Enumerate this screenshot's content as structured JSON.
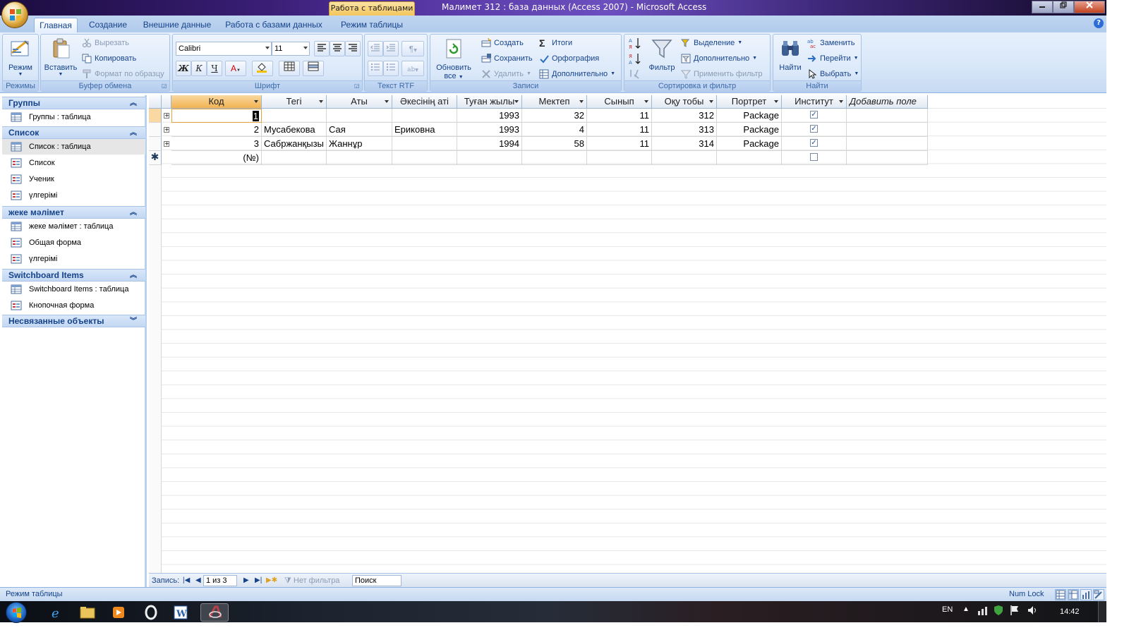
{
  "window": {
    "context_tab": "Работа с таблицами",
    "title": "Малимет 312 : база данных (Access 2007) - Microsoft Access",
    "minimize": "0",
    "restore": "1",
    "close": "r",
    "help": "?"
  },
  "tabs": [
    "Главная",
    "Создание",
    "Внешние данные",
    "Работа с базами данных",
    "Режим таблицы"
  ],
  "ribbon": {
    "modes": {
      "view_label": "Режим",
      "group": "Режимы"
    },
    "clipboard": {
      "paste_label": "Вставить",
      "cut": "Вырезать",
      "copy": "Копировать",
      "format_painter": "Формат по образцу",
      "group": "Буфер обмена"
    },
    "font": {
      "font_name": "Calibri",
      "font_size": "11",
      "bold": "Ж",
      "italic": "К",
      "underline": "Ч",
      "font_color": "A",
      "group": "Шрифт"
    },
    "rtf": {
      "group": "Текст RTF"
    },
    "records": {
      "refresh_label_1": "Обновить",
      "refresh_label_2": "все",
      "new": "Создать",
      "save": "Сохранить",
      "delete": "Удалить",
      "totals": "Итоги",
      "spelling": "Орфография",
      "more": "Дополнительно",
      "group": "Записи"
    },
    "sort_filter": {
      "filter_label": "Фильтр",
      "selection": "Выделение",
      "advanced": "Дополнительно",
      "apply_filter": "Применить фильтр",
      "group": "Сортировка и фильтр"
    },
    "find": {
      "find_label": "Найти",
      "replace": "Заменить",
      "goto": "Перейти",
      "select": "Выбрать",
      "group": "Найти"
    }
  },
  "nav": {
    "groups": [
      {
        "title": "Группы",
        "items": [
          {
            "label": "Группы : таблица",
            "type": "table"
          }
        ]
      },
      {
        "title": "Список",
        "items": [
          {
            "label": "Список : таблица",
            "type": "table",
            "selected": true
          },
          {
            "label": "Список",
            "type": "form"
          },
          {
            "label": "Ученик",
            "type": "form"
          },
          {
            "label": "үлгерімі",
            "type": "form"
          }
        ]
      },
      {
        "title": "жеке мәлімет",
        "items": [
          {
            "label": "жеке мәлімет : таблица",
            "type": "table"
          },
          {
            "label": "Общая форма",
            "type": "form"
          },
          {
            "label": "үлгерімі",
            "type": "form"
          }
        ]
      },
      {
        "title": "Switchboard Items",
        "items": [
          {
            "label": "Switchboard Items : таблица",
            "type": "table"
          },
          {
            "label": "Кнопочная форма",
            "type": "form"
          }
        ]
      },
      {
        "title": "Несвязанные объекты",
        "items": []
      }
    ]
  },
  "table": {
    "columns": [
      "Код",
      "Тегі",
      "Аты",
      "Әкесінің аті",
      "Туған жылы",
      "Мектеп",
      "Сынып",
      "Оқу тобы",
      "Портрет",
      "Институт",
      "Добавить поле"
    ],
    "rows": [
      {
        "code": "1",
        "surname": "",
        "name": "",
        "patronymic": "",
        "birth_year": "1993",
        "school": "32",
        "grade": "11",
        "study_group": "312",
        "portrait": "Package",
        "institute": true
      },
      {
        "code": "2",
        "surname": "Мусабекова",
        "name": "Сая",
        "patronymic": "Ериковна",
        "birth_year": "1993",
        "school": "4",
        "grade": "11",
        "study_group": "313",
        "portrait": "Package",
        "institute": true
      },
      {
        "code": "3",
        "surname": "Сабржанқызы",
        "name": "Жаннұр",
        "patronymic": "",
        "birth_year": "1994",
        "school": "58",
        "grade": "11",
        "study_group": "314",
        "portrait": "Package",
        "institute": true
      }
    ],
    "new_row_code": "(№)"
  },
  "record_nav": {
    "label": "Запись:",
    "position": "1 из 3",
    "filter_status": "Нет фильтра",
    "search": "Поиск"
  },
  "status": {
    "mode": "Режим таблицы",
    "numlock": "Num Lock"
  },
  "taskbar": {
    "lang": "EN",
    "clock": "14:42"
  },
  "colors": {
    "accent": "#15428b",
    "selected_header": "#f2b350",
    "ribbon_bg": "#d7e6f8"
  }
}
